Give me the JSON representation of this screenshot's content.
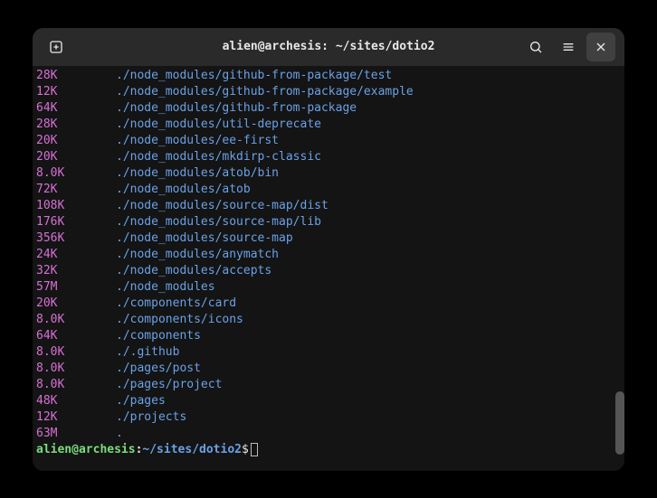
{
  "titlebar": {
    "title": "alien@archesis: ~/sites/dotio2"
  },
  "lines": [
    {
      "size": "28K",
      "path": "./node_modules/github-from-package/test"
    },
    {
      "size": "12K",
      "path": "./node_modules/github-from-package/example"
    },
    {
      "size": "64K",
      "path": "./node_modules/github-from-package"
    },
    {
      "size": "28K",
      "path": "./node_modules/util-deprecate"
    },
    {
      "size": "20K",
      "path": "./node_modules/ee-first"
    },
    {
      "size": "20K",
      "path": "./node_modules/mkdirp-classic"
    },
    {
      "size": "8.0K",
      "path": "./node_modules/atob/bin"
    },
    {
      "size": "72K",
      "path": "./node_modules/atob"
    },
    {
      "size": "108K",
      "path": "./node_modules/source-map/dist"
    },
    {
      "size": "176K",
      "path": "./node_modules/source-map/lib"
    },
    {
      "size": "356K",
      "path": "./node_modules/source-map"
    },
    {
      "size": "24K",
      "path": "./node_modules/anymatch"
    },
    {
      "size": "32K",
      "path": "./node_modules/accepts"
    },
    {
      "size": "57M",
      "path": "./node_modules"
    },
    {
      "size": "20K",
      "path": "./components/card"
    },
    {
      "size": "8.0K",
      "path": "./components/icons"
    },
    {
      "size": "64K",
      "path": "./components"
    },
    {
      "size": "8.0K",
      "path": "./.github"
    },
    {
      "size": "8.0K",
      "path": "./pages/post"
    },
    {
      "size": "8.0K",
      "path": "./pages/project"
    },
    {
      "size": "48K",
      "path": "./pages"
    },
    {
      "size": "12K",
      "path": "./projects"
    },
    {
      "size": "63M",
      "path": "."
    }
  ],
  "prompt": {
    "user": "alien@archesis",
    "colon": ":",
    "path": "~/sites/dotio2",
    "symbol": "$"
  }
}
